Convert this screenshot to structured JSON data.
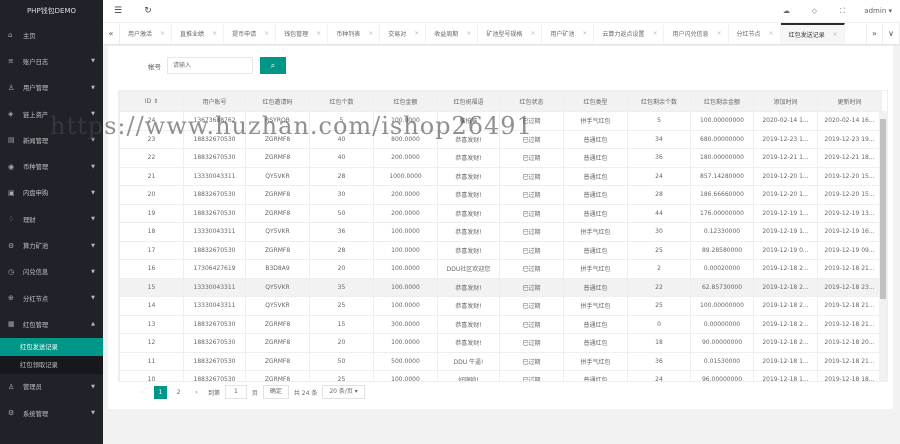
{
  "app": {
    "title": "PHP钱包DEMO"
  },
  "sidebar": {
    "items": [
      {
        "label": "主页",
        "icon": "home-icon",
        "glyph": "⌂",
        "arrow": ""
      },
      {
        "label": "账户日志",
        "icon": "log-icon",
        "glyph": "≡",
        "arrow": "▼"
      },
      {
        "label": "用户管理",
        "icon": "user-icon",
        "glyph": "♙",
        "arrow": "▼"
      },
      {
        "label": "链上资产",
        "icon": "asset-icon",
        "glyph": "◈",
        "arrow": "▼"
      },
      {
        "label": "新闻管理",
        "icon": "news-icon",
        "glyph": "▤",
        "arrow": "▼"
      },
      {
        "label": "币种管理",
        "icon": "coin-icon",
        "glyph": "◉",
        "arrow": "▼"
      },
      {
        "label": "内盘申购",
        "icon": "purchase-icon",
        "glyph": "▣",
        "arrow": "▼"
      },
      {
        "label": "理财",
        "icon": "finance-icon",
        "glyph": "♢",
        "arrow": "▼"
      },
      {
        "label": "算力矿池",
        "icon": "mining-icon",
        "glyph": "⚙",
        "arrow": "▼"
      },
      {
        "label": "闪兑信息",
        "icon": "exchange-icon",
        "glyph": "◷",
        "arrow": "▼"
      },
      {
        "label": "分红节点",
        "icon": "globe-icon",
        "glyph": "⊕",
        "arrow": "▼"
      },
      {
        "label": "红包管理",
        "icon": "redpacket-icon",
        "glyph": "▦",
        "arrow": "▲"
      }
    ],
    "sub_items": [
      {
        "label": "红包发送记录"
      },
      {
        "label": "红包领取记录"
      }
    ],
    "bottom_items": [
      {
        "label": "管理员",
        "icon": "admin-icon",
        "glyph": "♙",
        "arrow": "▼"
      },
      {
        "label": "系统管理",
        "icon": "settings-icon",
        "glyph": "⚙",
        "arrow": "▼"
      }
    ]
  },
  "header": {
    "menu_glyph": "☰",
    "refresh_glyph": "↻",
    "admin": "admin ▾"
  },
  "tabs": [
    "用户激活",
    "直推业绩",
    "提币申请",
    "钱包管理",
    "币种列表",
    "交易对",
    "收益周期",
    "矿池型号规格",
    "用户矿池",
    "云算力返点设置",
    "用户闪兑信息",
    "分红节点",
    "红包发送记录"
  ],
  "active_tab": 12,
  "search": {
    "label": "帐号",
    "placeholder": "请输入"
  },
  "table": {
    "headers": [
      "ID ⇕",
      "用户账号",
      "红包邀请码",
      "红包个数",
      "红包金额",
      "红包祝福语",
      "红包状态",
      "红包类型",
      "红包剩余个数",
      "红包剩余金额",
      "添加时间",
      "更新时间"
    ],
    "rows": [
      [
        "24",
        "13673688762",
        "RSYROB",
        "5",
        "100.0000",
        "脑拍脑",
        "已过期",
        "拼手气红包",
        "5",
        "100.00000000",
        "2020-02-14 1...",
        "2020-02-14 16..."
      ],
      [
        "23",
        "18832670530",
        "ZGRMF8",
        "40",
        "800.0000",
        "恭喜发财!",
        "已过期",
        "普通红包",
        "34",
        "680.00000000",
        "2019-12-23 1...",
        "2019-12-23 19..."
      ],
      [
        "22",
        "18832670530",
        "ZGRMF8",
        "40",
        "200.0000",
        "恭喜发财!",
        "已过期",
        "普通红包",
        "36",
        "180.00000000",
        "2019-12-21 1...",
        "2019-12-21 18..."
      ],
      [
        "21",
        "13330043311",
        "QY5VKR",
        "28",
        "1000.0000",
        "恭喜发财!",
        "已过期",
        "普通红包",
        "24",
        "857.14280000",
        "2019-12-20 1...",
        "2019-12-20 15..."
      ],
      [
        "20",
        "18832670530",
        "ZGRMF8",
        "30",
        "200.0000",
        "恭喜发财!",
        "已过期",
        "普通红包",
        "28",
        "186.66660000",
        "2019-12-20 1...",
        "2019-12-20 15..."
      ],
      [
        "19",
        "18832670530",
        "ZGRMF8",
        "50",
        "200.0000",
        "恭喜发财!",
        "已过期",
        "普通红包",
        "44",
        "176.00000000",
        "2019-12-19 1...",
        "2019-12-19 13..."
      ],
      [
        "18",
        "13330043311",
        "QY5VKR",
        "36",
        "100.0000",
        "恭喜发财!",
        "已过期",
        "拼手气红包",
        "30",
        "0.12330000",
        "2019-12-19 1...",
        "2019-12-19 16..."
      ],
      [
        "17",
        "18832670530",
        "ZGRMF8",
        "28",
        "100.0000",
        "恭喜发财!",
        "已过期",
        "普通红包",
        "25",
        "89.28580000",
        "2019-12-19 0...",
        "2019-12-19 09..."
      ],
      [
        "16",
        "17306427619",
        "B3D8A9",
        "20",
        "100.0000",
        "DDU社区欢迎您",
        "已过期",
        "拼手气红包",
        "2",
        "0.00020000",
        "2019-12-18 2...",
        "2019-12-18 21..."
      ],
      [
        "15",
        "13330043311",
        "QY5VKR",
        "35",
        "100.0000",
        "恭喜发财!",
        "已过期",
        "普通红包",
        "22",
        "62.85730000",
        "2019-12-18 2...",
        "2019-12-18 23..."
      ],
      [
        "14",
        "13330043311",
        "QY5VKR",
        "25",
        "100.0000",
        "恭喜发财!",
        "已过期",
        "拼手气红包",
        "25",
        "100.00000000",
        "2019-12-18 2...",
        "2019-12-18 21..."
      ],
      [
        "13",
        "18832670530",
        "ZGRMF8",
        "15",
        "300.0000",
        "恭喜发财!",
        "已过期",
        "普通红包",
        "0",
        "0.00000000",
        "2019-12-18 2...",
        "2019-12-18 21..."
      ],
      [
        "12",
        "18832670530",
        "ZGRMF8",
        "20",
        "100.0000",
        "恭喜发财!",
        "已过期",
        "普通红包",
        "18",
        "90.00000000",
        "2019-12-18 2...",
        "2019-12-18 20..."
      ],
      [
        "11",
        "18832670530",
        "ZGRMF8",
        "50",
        "500.0000",
        "DDU 牛逼!",
        "已过期",
        "拼手气红包",
        "36",
        "0.01530000",
        "2019-12-18 1...",
        "2019-12-18 21..."
      ],
      [
        "10",
        "18832670530",
        "ZGRMF8",
        "25",
        "100.0000",
        "好嗨哟!",
        "已过期",
        "普通红包",
        "24",
        "96.00000000",
        "2019-12-18 1...",
        "2019-12-18 18..."
      ]
    ],
    "highlight_row": 9
  },
  "pager": {
    "prev": "‹",
    "pages": [
      "1",
      "2"
    ],
    "next": "›",
    "goto": "到第",
    "page_value": "1",
    "page_unit": "页",
    "confirm": "确定",
    "total": "共 24 条",
    "per_page": "20 条/页 ▾"
  },
  "watermark": "https://www.huzhan.com/ishop26491",
  "colors": {
    "accent": "#009688",
    "sidebar": "#20222a"
  }
}
